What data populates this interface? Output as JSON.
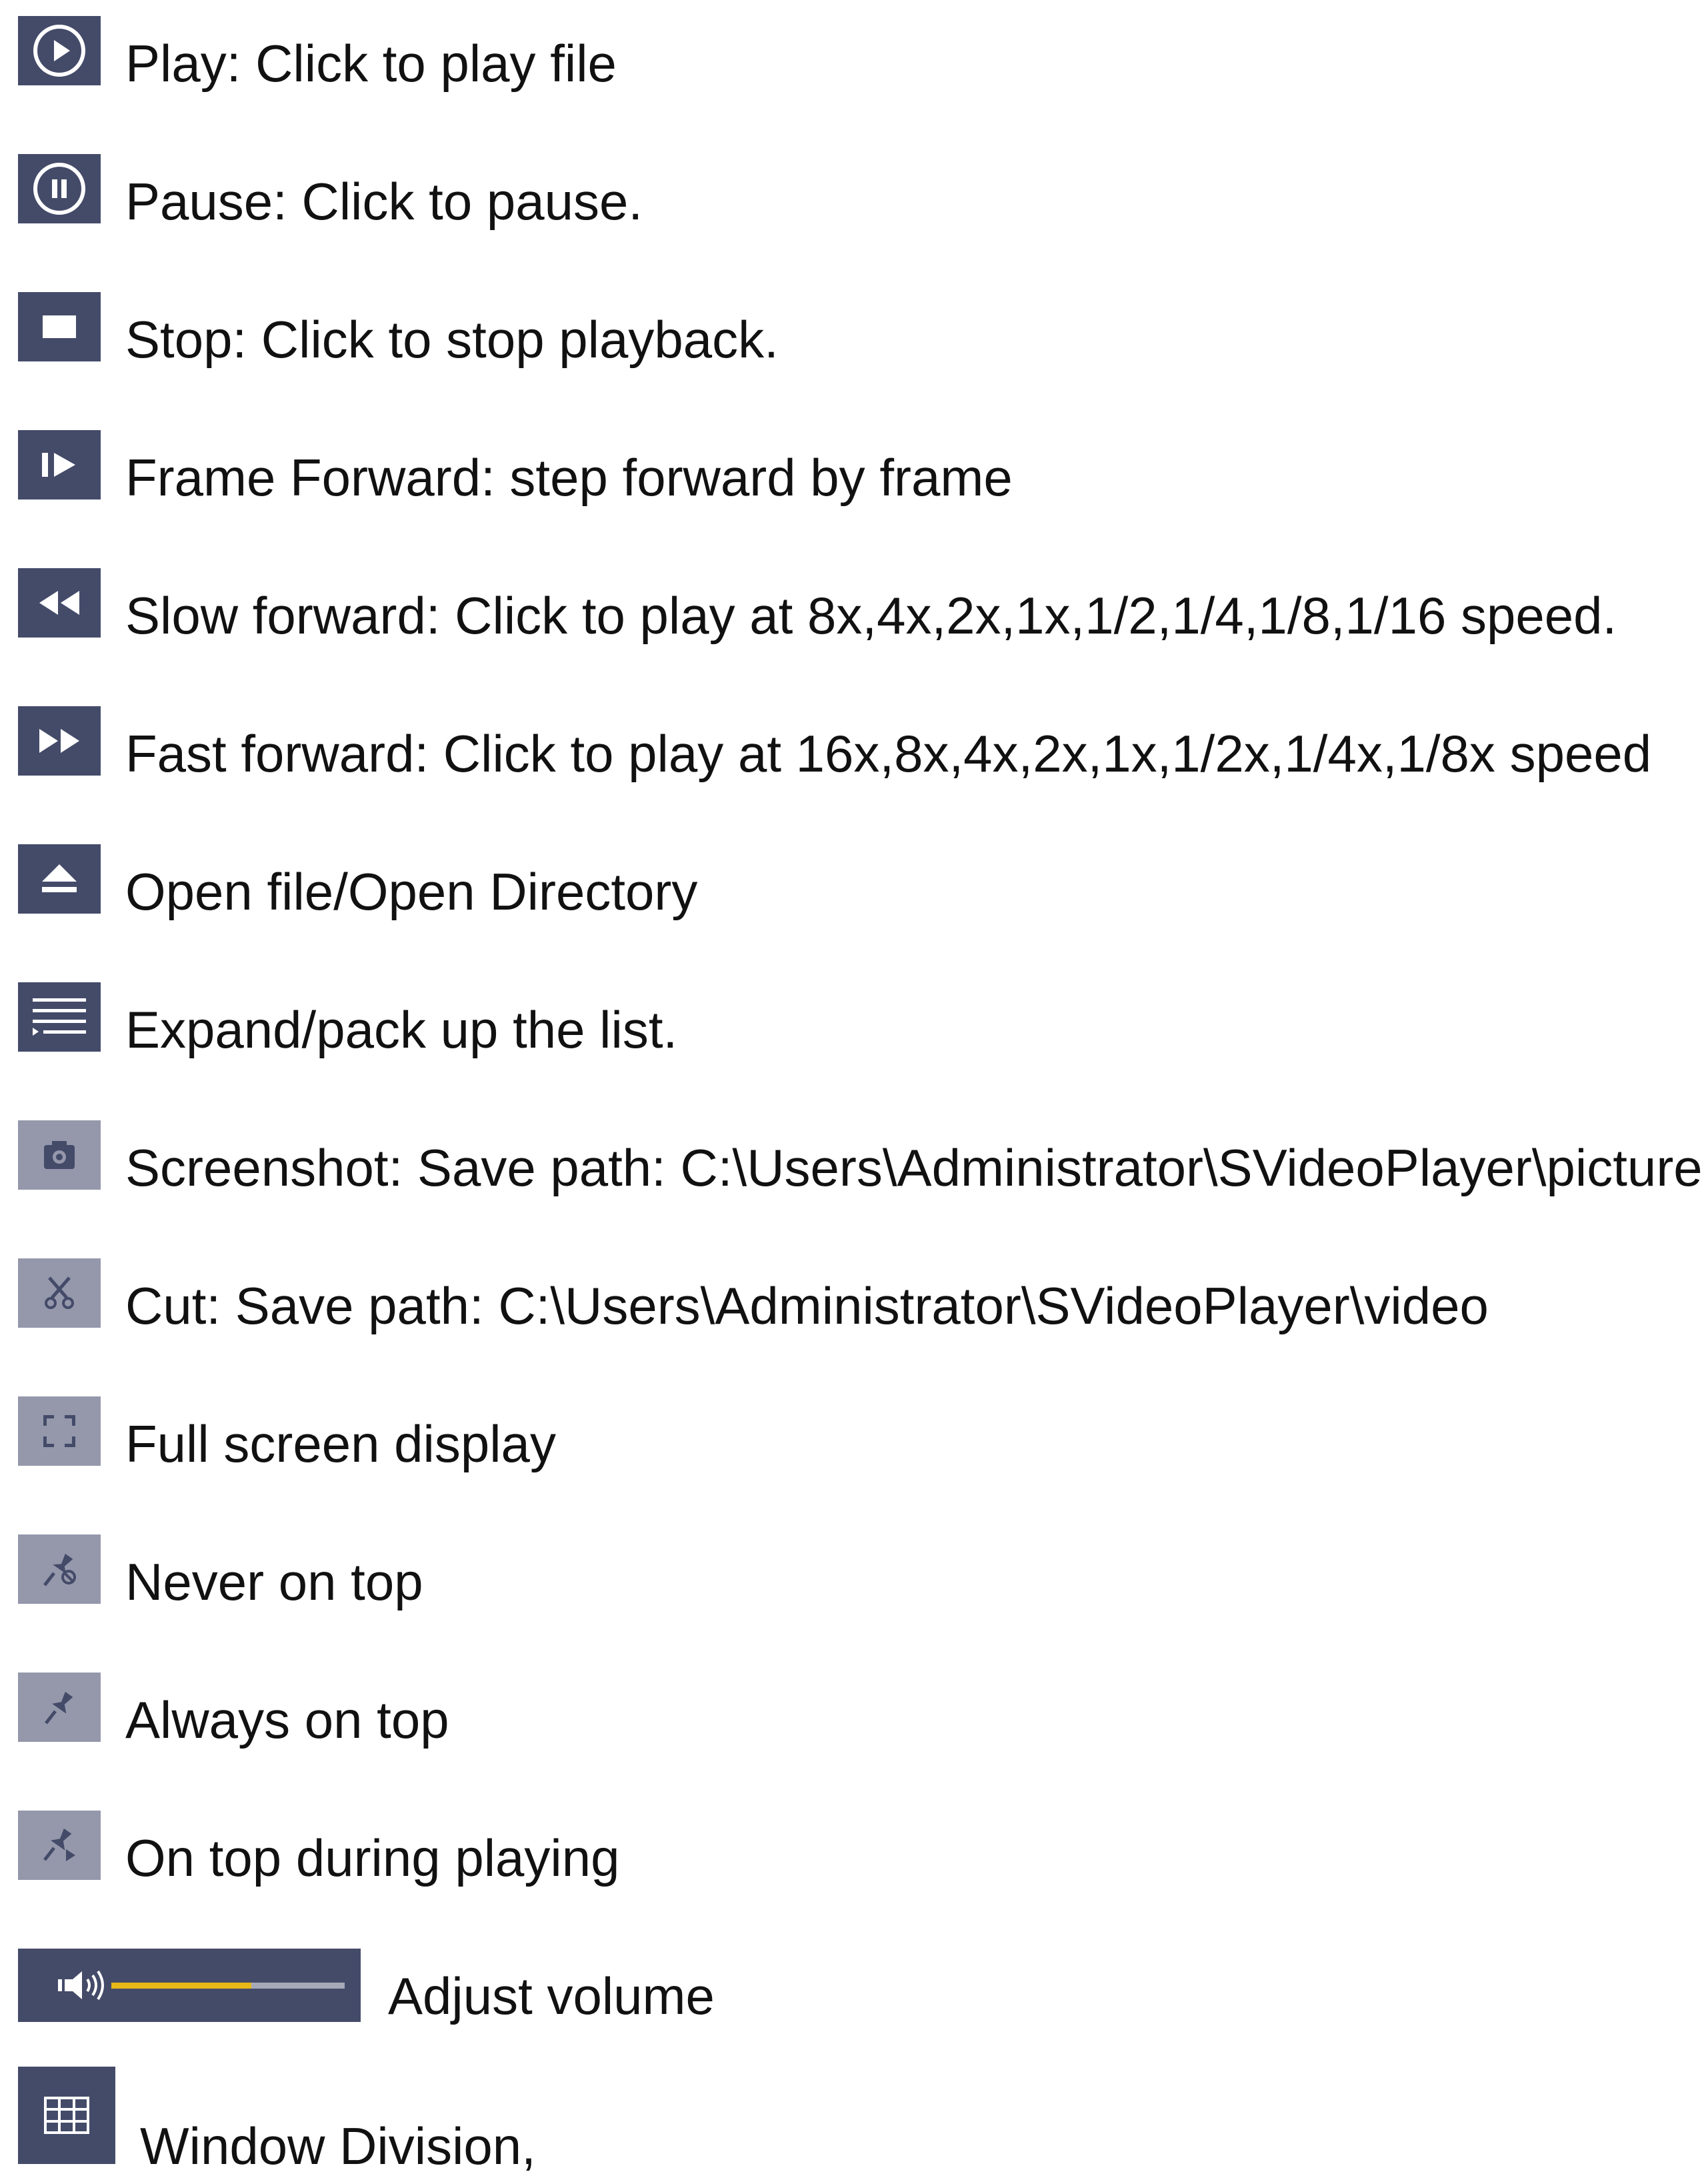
{
  "items": [
    {
      "icon": "play-icon",
      "text": "Play: Click to play file"
    },
    {
      "icon": "pause-icon",
      "text": "Pause: Click to pause."
    },
    {
      "icon": "stop-icon",
      "text": "Stop: Click to stop playback."
    },
    {
      "icon": "frame-forward-icon",
      "text": "Frame Forward: step forward by frame"
    },
    {
      "icon": "slow-forward-icon",
      "text": "Slow forward: Click to play at 8x,4x,2x,1x,1/2,1/4,1/8,1/16 speed."
    },
    {
      "icon": "fast-forward-icon",
      "text": "Fast forward: Click to play at 16x,8x,4x,2x,1x,1/2x,1/4x,1/8x speed"
    },
    {
      "icon": "eject-icon",
      "text": "Open file/Open Directory"
    },
    {
      "icon": "list-icon",
      "text": "Expand/pack up the list."
    },
    {
      "icon": "camera-icon",
      "text": "Screenshot: Save path: C:\\Users\\Administrator\\SVideoPlayer\\picture"
    },
    {
      "icon": "scissors-icon",
      "text": "Cut: Save path: C:\\Users\\Administrator\\SVideoPlayer\\video"
    },
    {
      "icon": "fullscreen-icon",
      "text": "Full screen display"
    },
    {
      "icon": "pin-off-icon",
      "text": "Never on top"
    },
    {
      "icon": "pin-icon",
      "text": "Always on top"
    },
    {
      "icon": "pin-play-icon",
      "text": "On top during playing"
    },
    {
      "icon": "volume-icon",
      "text": "Adjust volume"
    },
    {
      "icon": "grid-icon",
      "text": "Window Division,"
    }
  ],
  "volume_level": 0.6,
  "colors": {
    "button_dark": "#444b69",
    "button_light": "#9598ab",
    "volume_fill": "#e8b818",
    "volume_track": "#a7a9b8"
  }
}
